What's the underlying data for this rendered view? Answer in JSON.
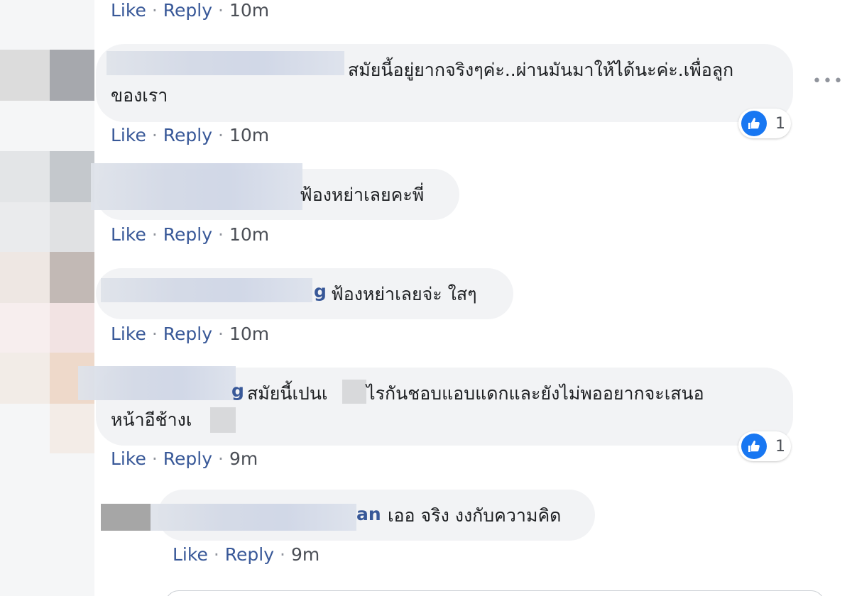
{
  "colors": {
    "link": "#385898",
    "bubble": "#f2f3f5",
    "like_blue": "#1877f2",
    "meta_text": "#4b4f56"
  },
  "actions": {
    "like": "Like",
    "reply": "Reply",
    "separator": "·"
  },
  "comments": [
    {
      "time": "10m"
    },
    {
      "name_tail": "",
      "text_line1": "สมัยนี้อยู่ยากจริงๆค่ะ..ผ่านมันมาให้ได้นะค่ะ.เพื่อลูก",
      "text_line2": "ของเรา",
      "time": "10m",
      "reactions": {
        "icon": "thumbs-up-icon",
        "count": "1"
      }
    },
    {
      "name_tail": "",
      "text_line1": "ฟ้องหย่าเลยคะพี่",
      "time": "10m"
    },
    {
      "name_tail": "g",
      "text_line1": "ฟ้องหย่าเลยจ่ะ ใสๆ",
      "time": "10m"
    },
    {
      "name_tail": "g",
      "text_line1_a": "สมัยนี้เปนเ",
      "text_line1_b": "ไรกันชอบแอบแดกและยังไม่พออยากจะเสนอ",
      "text_line2": "หน้าอีช้างเ",
      "time": "9m",
      "reactions": {
        "icon": "thumbs-up-icon",
        "count": "1"
      }
    },
    {
      "name_tail": "an",
      "text_line1": "เออ จริง งงกับความคิด",
      "time": "9m"
    }
  ],
  "more_options": "•••"
}
